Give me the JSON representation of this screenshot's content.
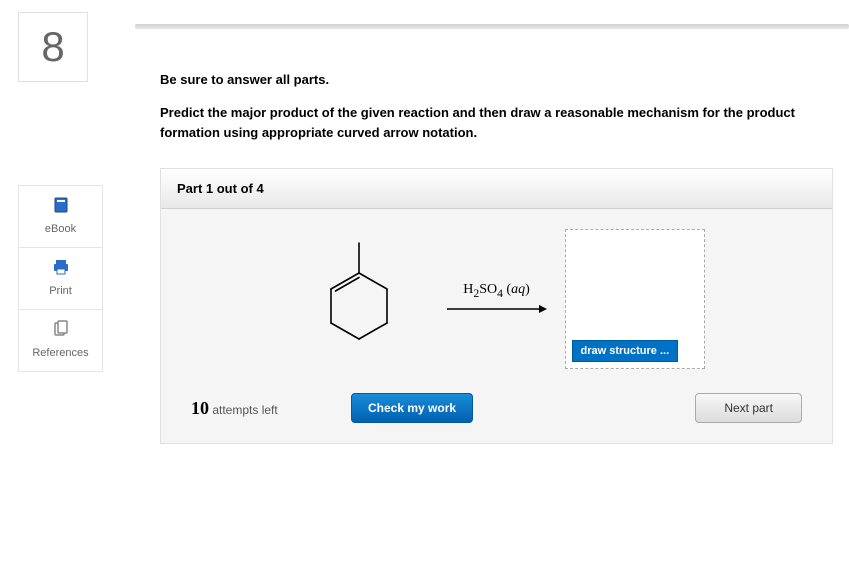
{
  "question_number": "8",
  "sidebar": {
    "items": [
      {
        "label": "eBook"
      },
      {
        "label": "Print"
      },
      {
        "label": "References"
      }
    ]
  },
  "instructions": {
    "line1": "Be sure to answer all parts.",
    "line2": "Predict the major product of the given reaction and then draw a reasonable mechanism for the product formation using appropriate curved arrow notation."
  },
  "part": {
    "header": "Part 1 out of 4",
    "reagent_html": "H₂SO₄ (aq)",
    "draw_button": "draw structure ..."
  },
  "footer": {
    "attempts_number": "10",
    "attempts_text": " attempts left",
    "check_button": "Check my work",
    "next_button": "Next part"
  }
}
